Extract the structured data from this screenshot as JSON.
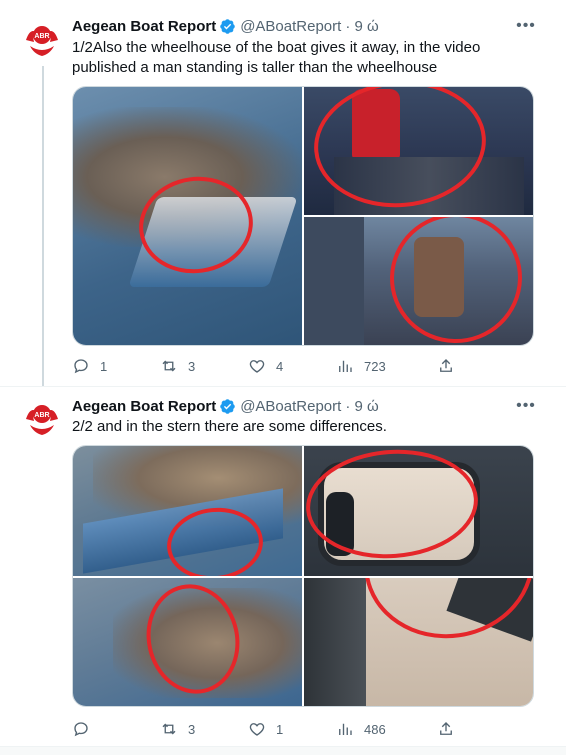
{
  "tweets": [
    {
      "author_name": "Aegean Boat Report",
      "handle": "@ABoatReport",
      "time": "· 9 ώ",
      "avatar_text": "ABR",
      "text": "1/2Also the wheelhouse of the boat gives it away, in the video published a man standing is taller than the wheelhouse",
      "stats": {
        "replies": "1",
        "reposts": "3",
        "likes": "4",
        "views": "723"
      }
    },
    {
      "author_name": "Aegean Boat Report",
      "handle": "@ABoatReport",
      "time": "· 9 ώ",
      "avatar_text": "ABR",
      "text": "2/2 and in the stern there are some differences.",
      "stats": {
        "reposts": "3",
        "likes": "1",
        "views": "486"
      }
    }
  ],
  "colors": {
    "accent": "#1d9bf0",
    "muted": "#536471",
    "ring": "#e5262a",
    "avatar_red": "#d61f26"
  },
  "icons": [
    "verified-badge-icon",
    "more-icon",
    "reply-icon",
    "repost-icon",
    "like-icon",
    "views-icon",
    "share-icon"
  ]
}
